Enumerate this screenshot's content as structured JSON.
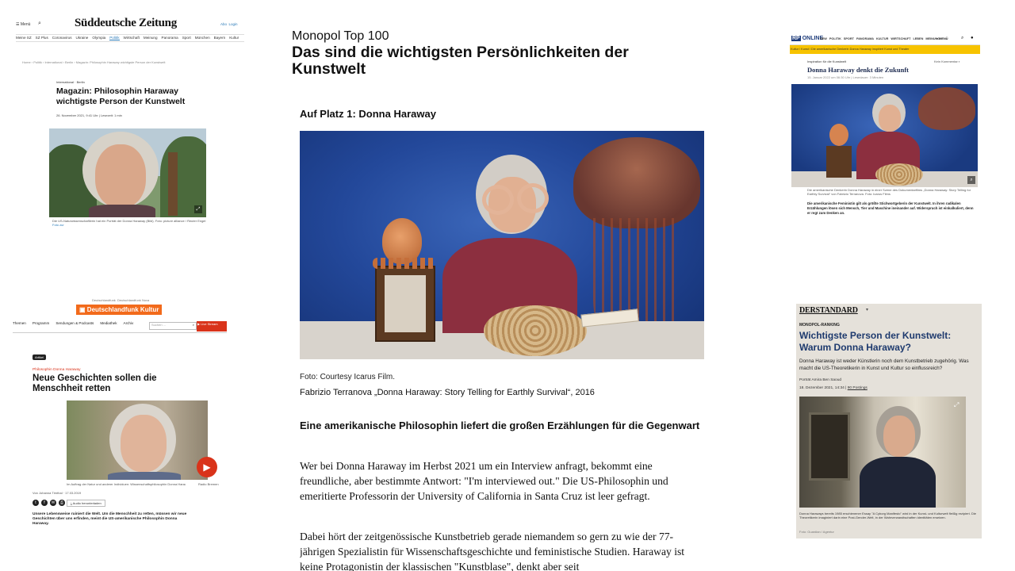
{
  "sz": {
    "menu_label": "Menü",
    "logo": "Süddeutsche Zeitung",
    "account": "Abo",
    "account2": "Login",
    "nav": [
      "Meine SZ",
      "SZ Plus",
      "Coronavirus",
      "Ukraine",
      "Olympia",
      "Politik",
      "Wirtschaft",
      "Meinung",
      "Panorama",
      "Sport",
      "München",
      "Bayern",
      "Kultur"
    ],
    "active_nav": "Politik",
    "breadcrumb": "Home › Politik › International › Berlin › Magazin: Philosophin Haraway wichtigste Person der Kunstwelt",
    "kicker": "International · Berlin",
    "headline": "Magazin: Philosophin Haraway wichtigste Person der Kunstwelt",
    "meta": "26. November 2021, 9:41 Uhr  |  Lesezeit: 1 min",
    "caption": "Die US-Naturwissenschaftlerin hat ein Porträt der Donna Haraway (Bild). Foto: picture alliance / Reuter Engel",
    "caption_link": "Foto zur"
  },
  "dlf": {
    "top_links": [
      "Deutschlandfunk",
      "Deutschlandfunk Nova"
    ],
    "brand": "Deutschlandfunk Kultur",
    "nav": [
      "Themen",
      "Programm",
      "Sendungen & Podcasts",
      "Mediathek",
      "Archiv"
    ],
    "search_placeholder": "Suchen ...",
    "live_button": "▶ Live Stream",
    "tag": "Artikel",
    "kicker": "Philosophin Donna Haraway",
    "headline": "Neue Geschichten sollen die Menschheit retten",
    "image_caption": "Im Auftrag der Natur und anderer Individuen: Wissenschaftsphilosophin Donna Haraway. © Getty Images",
    "image_credit": "Radio Bremen",
    "byline": "Von Johanna Tirnthal · 17.03.2019",
    "audio_button": "Audio herunterladen",
    "teaser": "Unsere Lebensweise ruiniert die Welt. Um die Menschheit zu retten, müssen wir neue Geschichten über uns erfinden, meint die US-amerikanische Philosophin Donna Haraway."
  },
  "main": {
    "overline": "Monopol Top 100",
    "title": "Das sind die wichtigsten Persönlichkeiten der Kunstwelt",
    "rank_heading": "Auf Platz 1: Donna Haraway",
    "photo_credit": "Foto: Courtesy Icarus Film.",
    "photo_caption": "Fabrizio Terranova „Donna Haraway: Story Telling for Earthly Survival“, 2016",
    "subheading": "Eine amerikanische Philosophin liefert die großen Erzählungen für die Gegenwart",
    "para1": "Wer bei Donna Haraway im Herbst 2021 um ein Interview anfragt, bekommt eine freundliche, aber bestimmte Antwort: \"I'm interviewed out.\" Die US-Philosophin und emeritierte Professorin der University of California in Santa Cruz ist leer gefragt.",
    "para2": "Dabei hört der zeitgenössische Kunstbetrieb gerade niemandem so gern zu wie der 77-jährigen Spezialistin für Wissenschaftsgeschichte und feministische Studien. Haraway ist keine Protagonistin der klassischen \"Kunstblase\", denkt aber seit"
  },
  "rp": {
    "logo_rp": "RP",
    "logo_online": "ONLINE",
    "nav": [
      "NEW",
      "POLITIK",
      "SPORT",
      "PANORAMA",
      "KULTUR",
      "WIRTSCHAFT",
      "LEBEN",
      "MEINUNG"
    ],
    "menu": "≡ MENÜ",
    "breadcrumb": [
      "Kultur",
      "Kunst",
      "Die amerikanische Denkerin Donna Haraway inspiriert Kunst und Theater"
    ],
    "kicker": "Inspiration für die Kunstwelt",
    "comments": "Kein Kommentar",
    "headline": "Donna Haraway denkt die Zukunft",
    "meta": "15. Januar 2022 um 06:30 Uhr | Lesedauer: 3 Minuten",
    "caption": "Die amerikanische Denkerin Donna Haraway in einer Szene des Dokumentarfilms „Donna Haraway: Story Telling for Earthly Survival“ von Fabrizio Terranova. Foto: Icarus Films",
    "teaser": "Die amerikanische Feministin gilt als größte Stichwortgeberin der Kunstwelt. In ihren radikalen Erzählungen lösen sich Mensch, Tier und Maschine ineinander auf. Widerspruch ist einkalkuliert, denn er regt zum Denken an."
  },
  "std": {
    "logo": "DERSTANDARD",
    "kicker": "MONOPOL-RANKING",
    "headline": "Wichtigste Person der Kunstwelt: Warum Donna Haraway?",
    "lead": "Donna Haraway ist weder Künstlerin noch dem Kunstbetrieb zugehörig. Was macht die US-Theoretikerin in Kunst und Kultur so einflussreich?",
    "byline": "Porträt Amira Ben Saoud",
    "date": "18. Dezember 2021, 14:34",
    "postings": "90 Postings",
    "caption": "Donna Haraways bereits 1985 erschienener Essay \"A Cyborg Manifesto\" wird in der Kunst- und Kulturwelt fleißig rezipiert. Die Theoretikerin imaginiert darin eine Post-Gender-Welt, in der Wahrverwandtschaften identitäten ersetzen.",
    "credit": "Foto: Guardian / Agentur"
  }
}
